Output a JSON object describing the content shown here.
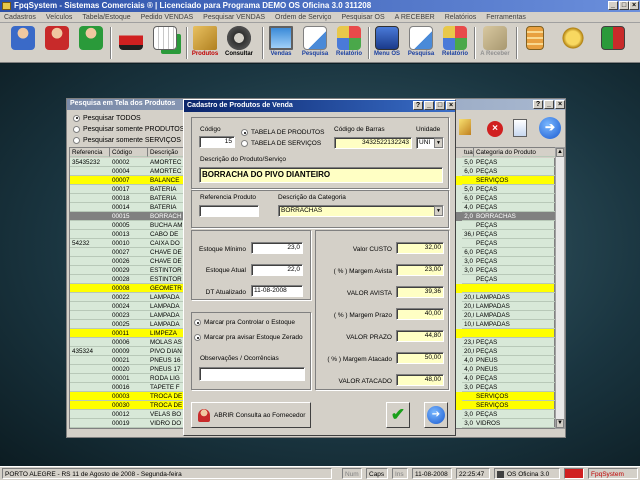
{
  "app": {
    "title": "FpqSystem - Sistemas Comerciais ® | Licenciado para Programa DEMO OS Oficina 3.0 311208"
  },
  "menu": [
    "Cadastros",
    "Veículos",
    "Tabela/Estoque",
    "Pedido VENDAS",
    "Pesquisar VENDAS",
    "Ordem de Serviço",
    "Pesquisar OS",
    "A RECEBER",
    "Relatórios",
    "Ferramentas"
  ],
  "toolbar": [
    {
      "label": "",
      "icon": "clients-icon"
    },
    {
      "label": "",
      "icon": "user-red-icon"
    },
    {
      "label": "",
      "icon": "user-green-icon"
    },
    {
      "label": "",
      "icon": "car-icon"
    },
    {
      "label": "",
      "icon": "calendar-icon"
    },
    {
      "label": "Produtos",
      "icon": "boxes-icon"
    },
    {
      "label": "Consultar",
      "icon": "tire-icon"
    },
    {
      "label": "Vendas",
      "icon": "monitor-icon"
    },
    {
      "label": "Pesquisa",
      "icon": "search-doc-icon"
    },
    {
      "label": "Relatório",
      "icon": "report-icon"
    },
    {
      "label": "Menu OS",
      "icon": "menu-os-icon"
    },
    {
      "label": "Pesquisa",
      "icon": "search-doc-icon"
    },
    {
      "label": "Relatório",
      "icon": "report-icon"
    },
    {
      "label": "A Receber",
      "icon": "money-icon"
    },
    {
      "label": "",
      "icon": "calculator-icon"
    },
    {
      "label": "",
      "icon": "coins-icon"
    },
    {
      "label": "",
      "icon": "exit-icon"
    }
  ],
  "bgwin": {
    "title": "Pesquisa em Tela dos Produtos",
    "radios": [
      "Pesquisar TODOS",
      "Pesquisar somente PRODUTOS",
      "Pesquisar somente SERVIÇOS"
    ],
    "headers": [
      "Referencia",
      "Código",
      "Descrição"
    ],
    "right_headers": [
      "tual",
      "Categoria do Produto"
    ],
    "rows": [
      {
        "ref": "35435232",
        "cod": "00002",
        "desc": "AMORTEC",
        "qty": "5,0",
        "cat": "PEÇAS",
        "hl": ""
      },
      {
        "ref": "",
        "cod": "00004",
        "desc": "AMORTEC",
        "qty": "6,0",
        "cat": "PEÇAS",
        "hl": ""
      },
      {
        "ref": "",
        "cod": "00007",
        "desc": "BALANCE",
        "qty": "",
        "cat": "SERVIÇOS",
        "hl": "y"
      },
      {
        "ref": "",
        "cod": "00017",
        "desc": "BATERIA",
        "qty": "5,0",
        "cat": "PEÇAS",
        "hl": ""
      },
      {
        "ref": "",
        "cod": "00018",
        "desc": "BATERIA",
        "qty": "6,0",
        "cat": "PEÇAS",
        "hl": ""
      },
      {
        "ref": "",
        "cod": "00014",
        "desc": "BATERIA",
        "qty": "4,0",
        "cat": "PEÇAS",
        "hl": ""
      },
      {
        "ref": "",
        "cod": "00015",
        "desc": "BORRACH",
        "qty": "2,0",
        "cat": "BORRACHAS",
        "hl": "s"
      },
      {
        "ref": "",
        "cod": "00005",
        "desc": "BUCHA AM",
        "qty": "",
        "cat": "PEÇAS",
        "hl": ""
      },
      {
        "ref": "",
        "cod": "00013",
        "desc": "CABO DE",
        "qty": "36,0",
        "cat": "PEÇAS",
        "hl": ""
      },
      {
        "ref": "54232",
        "cod": "00010",
        "desc": "CAIXA DO",
        "qty": "",
        "cat": "PEÇAS",
        "hl": ""
      },
      {
        "ref": "",
        "cod": "00027",
        "desc": "CHAVE DE",
        "qty": "6,0",
        "cat": "PEÇAS",
        "hl": ""
      },
      {
        "ref": "",
        "cod": "00026",
        "desc": "CHAVE DE",
        "qty": "3,0",
        "cat": "PEÇAS",
        "hl": ""
      },
      {
        "ref": "",
        "cod": "00029",
        "desc": "ESTINTOR",
        "qty": "3,0",
        "cat": "PEÇAS",
        "hl": ""
      },
      {
        "ref": "",
        "cod": "00028",
        "desc": "ESTINTOR",
        "qty": "",
        "cat": "PEÇAS",
        "hl": ""
      },
      {
        "ref": "",
        "cod": "00008",
        "desc": "GEOMETR",
        "qty": "",
        "cat": "",
        "hl": "y"
      },
      {
        "ref": "",
        "cod": "00022",
        "desc": "LAMPADA",
        "qty": "20,0",
        "cat": "LAMPADAS",
        "hl": ""
      },
      {
        "ref": "",
        "cod": "00024",
        "desc": "LAMPADA",
        "qty": "20,0",
        "cat": "LAMPADAS",
        "hl": ""
      },
      {
        "ref": "",
        "cod": "00023",
        "desc": "LAMPADA",
        "qty": "20,0",
        "cat": "LAMPADAS",
        "hl": ""
      },
      {
        "ref": "",
        "cod": "00025",
        "desc": "LAMPADA",
        "qty": "10,0",
        "cat": "LAMPADAS",
        "hl": ""
      },
      {
        "ref": "",
        "cod": "00011",
        "desc": "LIMPEZA",
        "qty": "",
        "cat": "",
        "hl": "y"
      },
      {
        "ref": "",
        "cod": "00006",
        "desc": "MOLAS AS",
        "qty": "23,0",
        "cat": "PEÇAS",
        "hl": ""
      },
      {
        "ref": "435324",
        "cod": "00009",
        "desc": "PIVO DIAN",
        "qty": "20,0",
        "cat": "PEÇAS",
        "hl": ""
      },
      {
        "ref": "",
        "cod": "00021",
        "desc": "PNEUS 16",
        "qty": "4,0",
        "cat": "PNEUS",
        "hl": ""
      },
      {
        "ref": "",
        "cod": "00020",
        "desc": "PNEUS 17",
        "qty": "4,0",
        "cat": "PNEUS",
        "hl": ""
      },
      {
        "ref": "",
        "cod": "00001",
        "desc": "RODA LIG",
        "qty": "4,0",
        "cat": "PEÇAS",
        "hl": ""
      },
      {
        "ref": "",
        "cod": "00016",
        "desc": "TAPETE F",
        "qty": "3,0",
        "cat": "PEÇAS",
        "hl": ""
      },
      {
        "ref": "",
        "cod": "00003",
        "desc": "TROCA DE",
        "qty": "",
        "cat": "SERVIÇOS",
        "hl": "y"
      },
      {
        "ref": "",
        "cod": "00030",
        "desc": "TROCA DE",
        "qty": "",
        "cat": "SERVIÇOS",
        "hl": "y"
      },
      {
        "ref": "",
        "cod": "00012",
        "desc": "VELAS BO",
        "qty": "3,0",
        "cat": "PEÇAS",
        "hl": ""
      },
      {
        "ref": "",
        "cod": "00019",
        "desc": "VIDRO DO",
        "qty": "3,0",
        "cat": "VIDROS",
        "hl": ""
      }
    ]
  },
  "dialog": {
    "title": "Cadastro de Produtos de Venda",
    "codigo_label": "Código",
    "codigo_value": "15",
    "radio_produtos": "TABELA DE PRODUTOS",
    "radio_servicos": "TABELA DE SERVIÇOS",
    "barcode_label": "Código de Barras",
    "barcode_value": "3432522132243",
    "unidade_label": "Unidade",
    "unidade_value": "UNI",
    "descricao_label": "Descrição do Produto/Serviço",
    "descricao_value": "BORRACHA DO PIVO DIANTEIRO",
    "referencia_label": "Referencia Produto",
    "referencia_value": "",
    "categoria_label": "Descrição da Categoria",
    "categoria_value": "BORRACHAS",
    "estoque_minimo_label": "Estoque Mínimo",
    "estoque_minimo_value": "23,0",
    "estoque_atual_label": "Estoque Atual",
    "estoque_atual_value": "22,0",
    "dt_atualizado_label": "DT Atualizado",
    "dt_atualizado_value": "11-08-2008",
    "valor_custo_label": "Valor CUSTO",
    "valor_custo_value": "32,00",
    "margem_avista_label": "( % ) Margem Avista",
    "margem_avista_value": "23,00",
    "valor_avista_label": "VALOR AVISTA",
    "valor_avista_value": "39,36",
    "margem_prazo_label": "( % ) Margem Prazo",
    "margem_prazo_value": "40,00",
    "valor_prazo_label": "VALOR PRAZO",
    "valor_prazo_value": "44,80",
    "margem_atacado_label": "( % ) Margem Atacado",
    "margem_atacado_value": "50,00",
    "valor_atacado_label": "VALOR ATACADO",
    "valor_atacado_value": "48,00",
    "radio_controlar": "Marcar pra Controlar o Estoque",
    "radio_avisar": "Marcar pra avisar Estoque Zerado",
    "observacoes_label": "Observações / Ocorrências",
    "observacoes_value": "",
    "fornecedor_button": "ABRIR Consulta ao Fornecedor"
  },
  "status": {
    "location": "PORTO ALEGRE - RS 11 de Agosto de 2008 - Segunda-feira",
    "num": "Num",
    "caps": "Caps",
    "ins": "Ins",
    "date": "11-08-2008",
    "time": "22:25:47",
    "os": "OS Oficina 3.0",
    "brand": "FpqSystem"
  },
  "colors": {
    "yellow_row": "#ffff00",
    "green_row": "#d8e8d8",
    "selected_row": "#808080",
    "title_active": "#0a246a"
  }
}
